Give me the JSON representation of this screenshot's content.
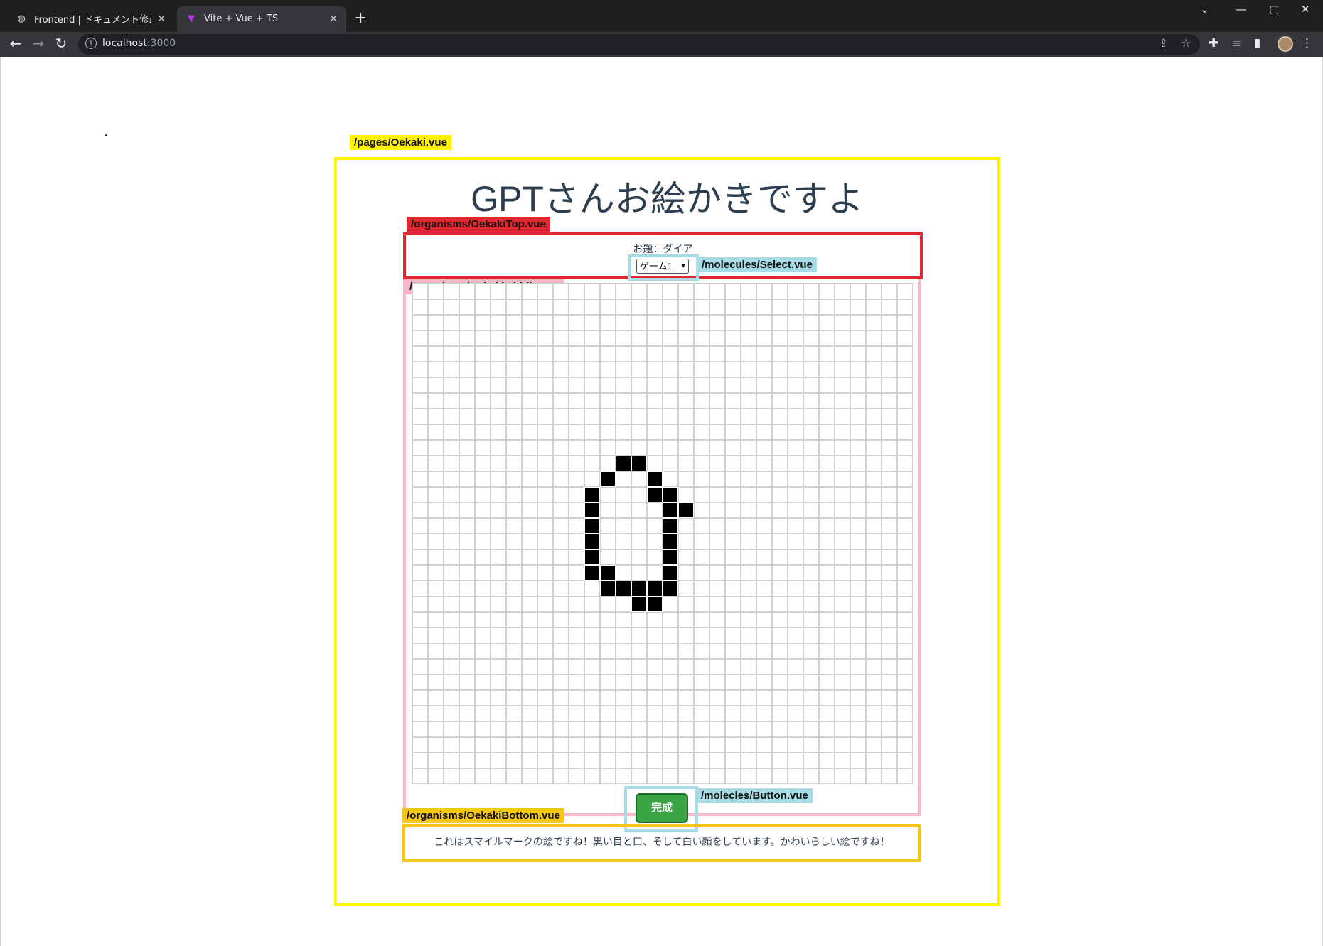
{
  "browser": {
    "tabs": [
      {
        "label": "Frontend | ドキュメント修正 · Issue",
        "icon": "github-icon",
        "active": false
      },
      {
        "label": "Vite + Vue + TS",
        "icon": "vite-icon",
        "active": true
      }
    ],
    "new_tab": "+",
    "url_host": "localhost",
    "url_port": ":3000",
    "window_controls": [
      "⌄",
      "—",
      "▢",
      "✕"
    ]
  },
  "annotations": {
    "page": "/pages/Oekaki.vue",
    "top": "/organisms/OekakiTop.vue",
    "select": "/molecules/Select.vue",
    "middle": "/organisms/OekakiMiddle.vue",
    "button": "/molecles/Button.vue",
    "bottom": "/organisms/OekakiBottom.vue"
  },
  "page": {
    "title": "GPTさんお絵かきですよ",
    "topic": "お題：ダイア",
    "select_value": "ゲーム1",
    "done_button": "完成",
    "result_text": "これはスマイルマークの絵ですね！黒い目と口、そして白い顔をしています。かわいらしい絵ですね！"
  },
  "canvas": {
    "size": 32,
    "filled": [
      [
        11,
        13
      ],
      [
        11,
        14
      ],
      [
        12,
        12
      ],
      [
        12,
        15
      ],
      [
        13,
        11
      ],
      [
        13,
        15
      ],
      [
        13,
        16
      ],
      [
        14,
        11
      ],
      [
        14,
        16
      ],
      [
        14,
        17
      ],
      [
        15,
        11
      ],
      [
        15,
        16
      ],
      [
        16,
        11
      ],
      [
        16,
        16
      ],
      [
        17,
        11
      ],
      [
        17,
        16
      ],
      [
        18,
        11
      ],
      [
        18,
        12
      ],
      [
        18,
        16
      ],
      [
        19,
        12
      ],
      [
        19,
        13
      ],
      [
        19,
        14
      ],
      [
        19,
        15
      ],
      [
        19,
        16
      ],
      [
        20,
        14
      ],
      [
        20,
        15
      ]
    ]
  },
  "colors": {
    "page_frame": "#fff200",
    "top_frame": "#e3262f",
    "middle_frame": "#f7b5c8",
    "bottom_frame": "#f5c518",
    "component_frame": "#a7dbe6",
    "button": "#3aa345"
  }
}
